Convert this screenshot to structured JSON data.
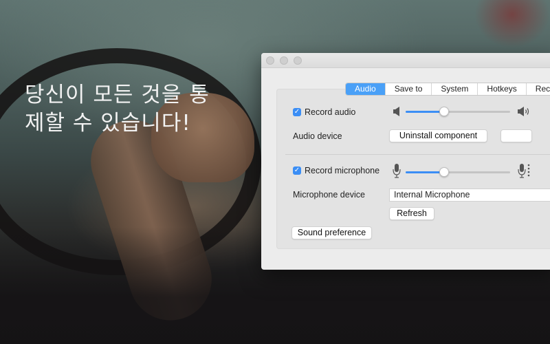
{
  "promo": {
    "headline_line1": "당신이 모든 것을 통",
    "headline_line2": "제할 수 있습니다!"
  },
  "window": {
    "tabs": [
      {
        "label": "Audio",
        "active": true
      },
      {
        "label": "Save to",
        "active": false
      },
      {
        "label": "System",
        "active": false
      },
      {
        "label": "Hotkeys",
        "active": false
      },
      {
        "label": "Reco",
        "active": false
      }
    ],
    "audio": {
      "record_audio_label": "Record audio",
      "record_audio_checked": true,
      "volume_level": 0.37,
      "device_label": "Audio device",
      "uninstall_label": "Uninstall component",
      "extra_button_label": ""
    },
    "microphone": {
      "record_mic_label": "Record microphone",
      "record_mic_checked": true,
      "mic_level": 0.37,
      "device_label": "Microphone device",
      "device_value": "Internal Microphone",
      "refresh_label": "Refresh"
    },
    "sound_preference_label": "Sound preference"
  },
  "colors": {
    "accent": "#3b8ef5",
    "tab_active": "#4aa0f7",
    "window_bg": "#ececec",
    "panel_bg": "#e3e3e3"
  },
  "icons": {
    "volume_low": "speaker-low-icon",
    "volume_high": "speaker-high-icon",
    "mic_low": "microphone-icon",
    "mic_high": "microphone-level-icon"
  }
}
